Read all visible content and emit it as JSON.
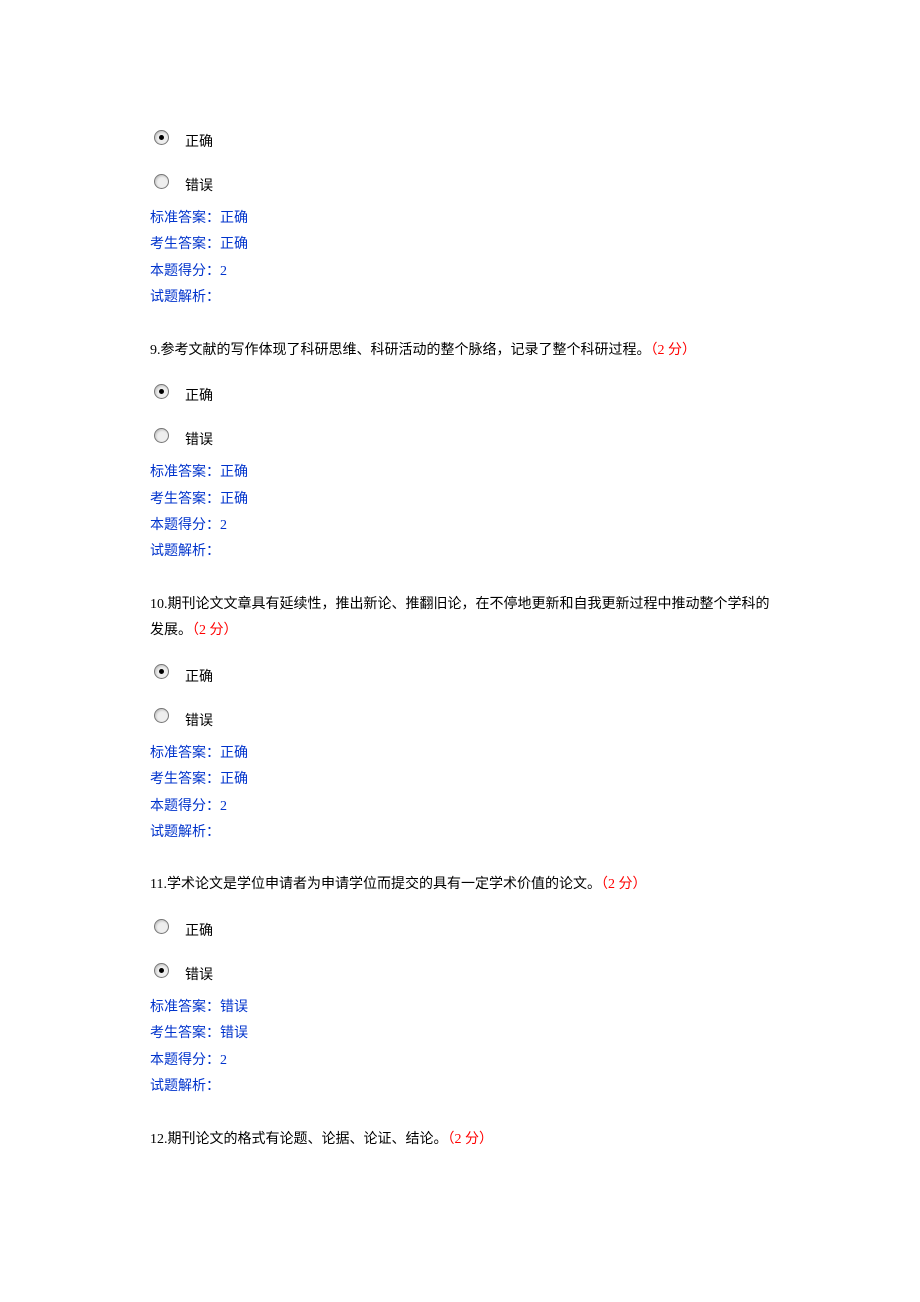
{
  "labels": {
    "correct": "正确",
    "wrong": "错误",
    "std_answer_prefix": "标准答案：",
    "user_answer_prefix": "考生答案：",
    "score_prefix": "本题得分：",
    "analysis_prefix": "试题解析："
  },
  "questions": [
    {
      "number": "",
      "text": "",
      "points": "",
      "selected": "correct",
      "std_answer": "正确",
      "user_answer": "正确",
      "score": "2",
      "analysis": ""
    },
    {
      "number": "9.",
      "text": "参考文献的写作体现了科研思维、科研活动的整个脉络，记录了整个科研过程。",
      "points": "（2 分）",
      "selected": "correct",
      "std_answer": "正确",
      "user_answer": "正确",
      "score": "2",
      "analysis": ""
    },
    {
      "number": "10.",
      "text": "期刊论文文章具有延续性，推出新论、推翻旧论，在不停地更新和自我更新过程中推动整个学科的发展。",
      "points": "（2 分）",
      "selected": "correct",
      "std_answer": "正确",
      "user_answer": "正确",
      "score": "2",
      "analysis": ""
    },
    {
      "number": "11.",
      "text": "学术论文是学位申请者为申请学位而提交的具有一定学术价值的论文。",
      "points": "（2 分）",
      "selected": "wrong",
      "std_answer": "错误",
      "user_answer": "错误",
      "score": "2",
      "analysis": ""
    },
    {
      "number": "12.",
      "text": "期刊论文的格式有论题、论据、论证、结论。",
      "points": "（2 分）",
      "selected": null,
      "std_answer": null,
      "user_answer": null,
      "score": null,
      "analysis": null
    }
  ]
}
